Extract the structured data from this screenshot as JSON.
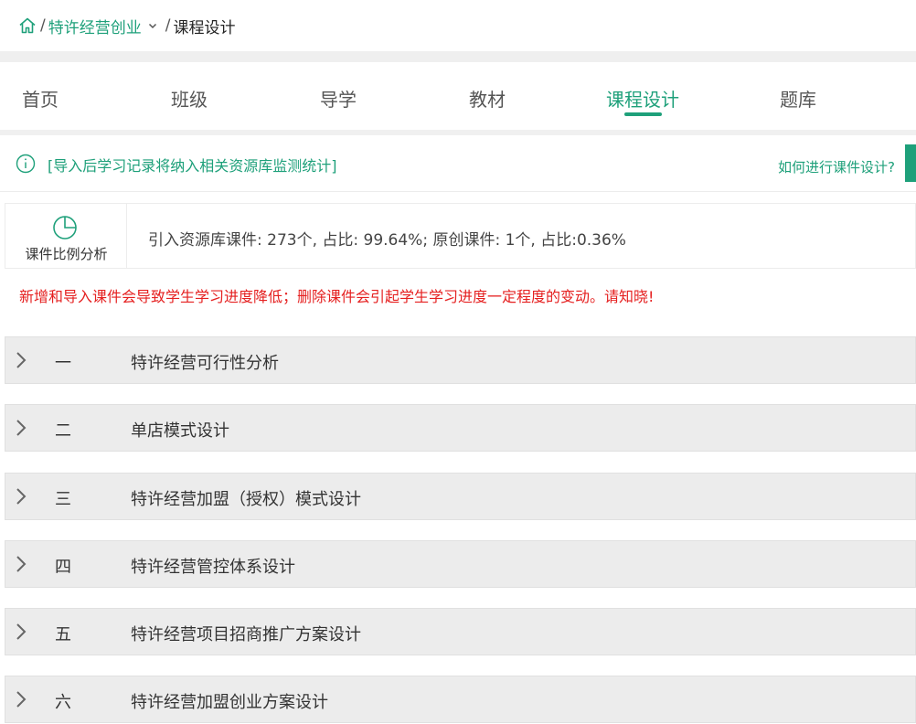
{
  "breadcrumb": {
    "items": [
      "特许经营创业",
      "课程设计"
    ],
    "separator": "/"
  },
  "tabs": [
    {
      "label": "首页",
      "active": false
    },
    {
      "label": "班级",
      "active": false
    },
    {
      "label": "导学",
      "active": false
    },
    {
      "label": "教材",
      "active": false
    },
    {
      "label": "课程设计",
      "active": true
    },
    {
      "label": "题库",
      "active": false
    }
  ],
  "notice": {
    "text": "[导入后学习记录将纳入相关资源库监测统计]",
    "help_link": "如何进行课件设计?"
  },
  "stats": {
    "ratio_label": "课件比例分析",
    "text": "引入资源库课件: 273个, 占比: 99.64%; 原创课件: 1个, 占比:0.36%"
  },
  "warning": "新增和导入课件会导致学生学习进度降低；删除课件会引起学生学习进度一定程度的变动。请知晓!",
  "chapters": [
    {
      "num": "一",
      "title": "特许经营可行性分析"
    },
    {
      "num": "二",
      "title": "单店模式设计"
    },
    {
      "num": "三",
      "title": "特许经营加盟（授权）模式设计"
    },
    {
      "num": "四",
      "title": "特许经营管控体系设计"
    },
    {
      "num": "五",
      "title": "特许经营项目招商推广方案设计"
    },
    {
      "num": "六",
      "title": "特许经营加盟创业方案设计"
    }
  ],
  "colors": {
    "accent": "#1ea07a",
    "warning": "#e52020",
    "chapter_bg": "#ececec"
  }
}
